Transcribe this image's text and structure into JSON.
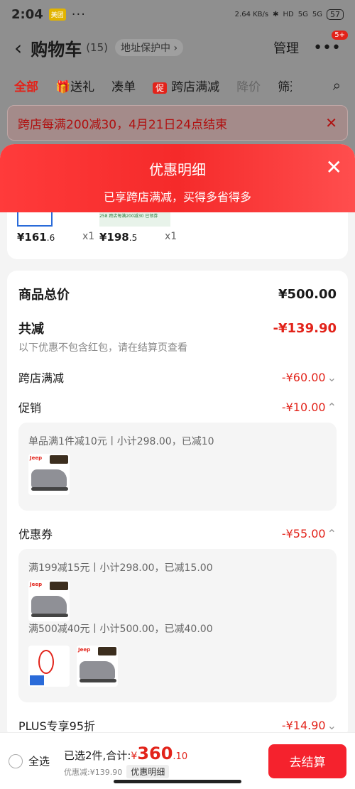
{
  "status": {
    "time": "2:04",
    "app_badge": "美团",
    "dots": "···",
    "net": "2.64 KB/s",
    "hd": "HD",
    "sig1": "5G",
    "sig2": "5G",
    "battery": "57"
  },
  "nav": {
    "title": "购物车",
    "count": "(15)",
    "address": "地址保护中",
    "manage": "管理",
    "more_badge": "5+"
  },
  "tabs": [
    "全部",
    "送礼",
    "凑单",
    "跨店满减",
    "降价",
    "筛选"
  ],
  "promo_banner": "跨店每满200减30，4月21日24点结束",
  "sheet": {
    "title": "优惠明细",
    "subtitle": "已享跨店满减，买得多省得多"
  },
  "products": [
    {
      "price": "¥161",
      "dec": ".6",
      "qty": "x1"
    },
    {
      "price": "¥198",
      "dec": ".5",
      "qty": "x1"
    }
  ],
  "product_promo_mini": "258 跨店每满200减30 已领券",
  "breakdown": {
    "total_label": "商品总价",
    "total": "¥500.00",
    "reduce_label": "共减",
    "reduce": "-¥139.90",
    "note": "以下优惠不包含红包，请在结算页查看",
    "cross_label": "跨店满减",
    "cross": "-¥60.00",
    "promo_label": "促销",
    "promo": "-¥10.00",
    "promo_detail": "单品满1件减10元丨小计298.00，已减10",
    "coupon_label": "优惠券",
    "coupon": "-¥55.00",
    "coupon_detail1": "满199减15元丨小计298.00，已减15.00",
    "coupon_detail2": "满500减40元丨小计500.00，已减40.00",
    "plus_label": "PLUS专享95折",
    "plus": "-¥14.90"
  },
  "bottom": {
    "select_all": "全选",
    "selected": "已选2件,合计:",
    "currency": "¥",
    "total_int": "360",
    "total_dec": ".10",
    "saved": "优惠减:¥139.90",
    "detail": "优惠明细",
    "checkout": "去结算"
  },
  "icons": {
    "back": "chevron-left-icon",
    "close": "close-icon",
    "search": "search-icon",
    "gift": "gift-icon"
  }
}
